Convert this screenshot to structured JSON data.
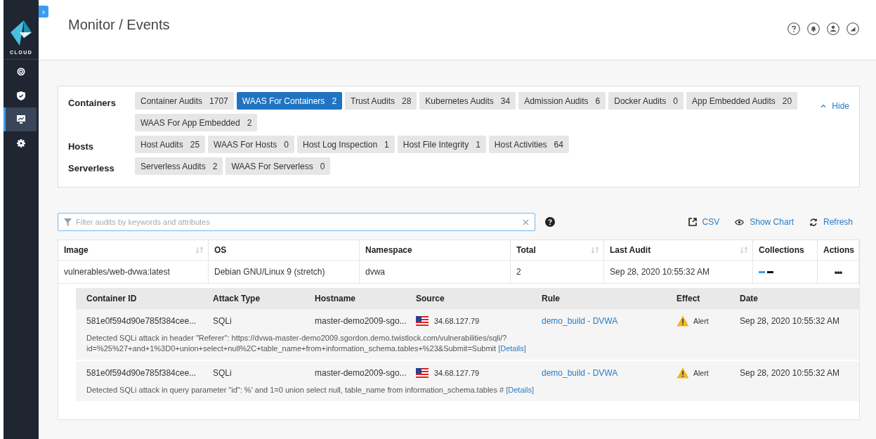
{
  "sidebar": {
    "logo_text": "CLOUD",
    "items": [
      {
        "kind": "radar",
        "selected": false
      },
      {
        "kind": "shield",
        "selected": false
      },
      {
        "kind": "monitor",
        "selected": true
      },
      {
        "kind": "gear",
        "selected": false
      }
    ]
  },
  "expand_toggle": "›",
  "header": {
    "title": "Monitor / Events"
  },
  "categories": [
    {
      "label": "Containers",
      "tabs": [
        {
          "label": "Container Audits",
          "count": "1707",
          "selected": false
        },
        {
          "label": "WAAS For Containers",
          "count": "2",
          "selected": true
        },
        {
          "label": "Trust Audits",
          "count": "28",
          "selected": false
        },
        {
          "label": "Kubernetes Audits",
          "count": "34",
          "selected": false
        },
        {
          "label": "Admission Audits",
          "count": "6",
          "selected": false
        },
        {
          "label": "Docker Audits",
          "count": "0",
          "selected": false
        },
        {
          "label": "App Embedded Audits",
          "count": "20",
          "selected": false
        },
        {
          "label": "WAAS For App Embedded",
          "count": "2",
          "selected": false
        }
      ]
    },
    {
      "label": "Hosts",
      "tabs": [
        {
          "label": "Host Audits",
          "count": "25",
          "selected": false
        },
        {
          "label": "WAAS For Hosts",
          "count": "0",
          "selected": false
        },
        {
          "label": "Host Log Inspection",
          "count": "1",
          "selected": false
        },
        {
          "label": "Host File Integrity",
          "count": "1",
          "selected": false
        },
        {
          "label": "Host Activities",
          "count": "64",
          "selected": false
        }
      ]
    },
    {
      "label": "Serverless",
      "tabs": [
        {
          "label": "Serverless Audits",
          "count": "2",
          "selected": false
        },
        {
          "label": "WAAS For Serverless",
          "count": "0",
          "selected": false
        }
      ]
    }
  ],
  "hide_link": "Hide",
  "filter": {
    "placeholder": "Filter audits by keywords and attributes"
  },
  "toolbar": [
    {
      "kind": "export",
      "label": "CSV"
    },
    {
      "kind": "eye",
      "label": "Show Chart"
    },
    {
      "kind": "refresh",
      "label": "Refresh"
    }
  ],
  "table": {
    "columns": [
      {
        "label": "Image",
        "sortable": true
      },
      {
        "label": "OS",
        "sortable": false
      },
      {
        "label": "Namespace",
        "sortable": false
      },
      {
        "label": "Total",
        "sortable": true
      },
      {
        "label": "Last Audit",
        "sortable": true
      },
      {
        "label": "Collections",
        "sortable": false
      },
      {
        "label": "Actions",
        "sortable": false
      }
    ],
    "rows": [
      {
        "image": "vulnerables/web-dvwa:latest",
        "os": "Debian GNU/Linux 9 (stretch)",
        "namespace": "dvwa",
        "total": "2",
        "last_audit": "Sep 28, 2020 10:55:32 AM",
        "collections": [
          {
            "color": "#3b9cf0"
          },
          {
            "color": "#111111"
          }
        ],
        "actions": "•••"
      }
    ]
  },
  "events": {
    "columns": [
      "Container ID",
      "Attack Type",
      "Hostname",
      "Source",
      "Rule",
      "Effect",
      "Date"
    ],
    "rows": [
      {
        "container_id": "581e0f594d90e785f384cee...",
        "attack_type": "SQLi",
        "hostname": "master-demo2009-sgo...",
        "source": "34.68.127.79",
        "rule": "demo_build - DVWA",
        "effect": "Alert",
        "date": "Sep 28, 2020 10:55:32 AM",
        "message_lines": [
          "Detected SQLi attack in header \"Referer\": https://dvwa-master-demo2009.sgordon.demo.twistlock.com/vulnerabilities/sqli/?",
          "id=%25%27+and+1%3D0+union+select+null%2C+table_name+from+information_schema.tables+%23&Submit=Submit"
        ],
        "details": "[Details]"
      },
      {
        "container_id": "581e0f594d90e785f384cee...",
        "attack_type": "SQLi",
        "hostname": "master-demo2009-sgo...",
        "source": "34.68.127.79",
        "rule": "demo_build - DVWA",
        "effect": "Alert",
        "date": "Sep 28, 2020 10:55:32 AM",
        "message_lines": [
          "Detected SQLi attack in query parameter \"id\": %' and 1=0 union select null, table_name from information_schema.tables #"
        ],
        "details": "[Details]"
      }
    ]
  }
}
